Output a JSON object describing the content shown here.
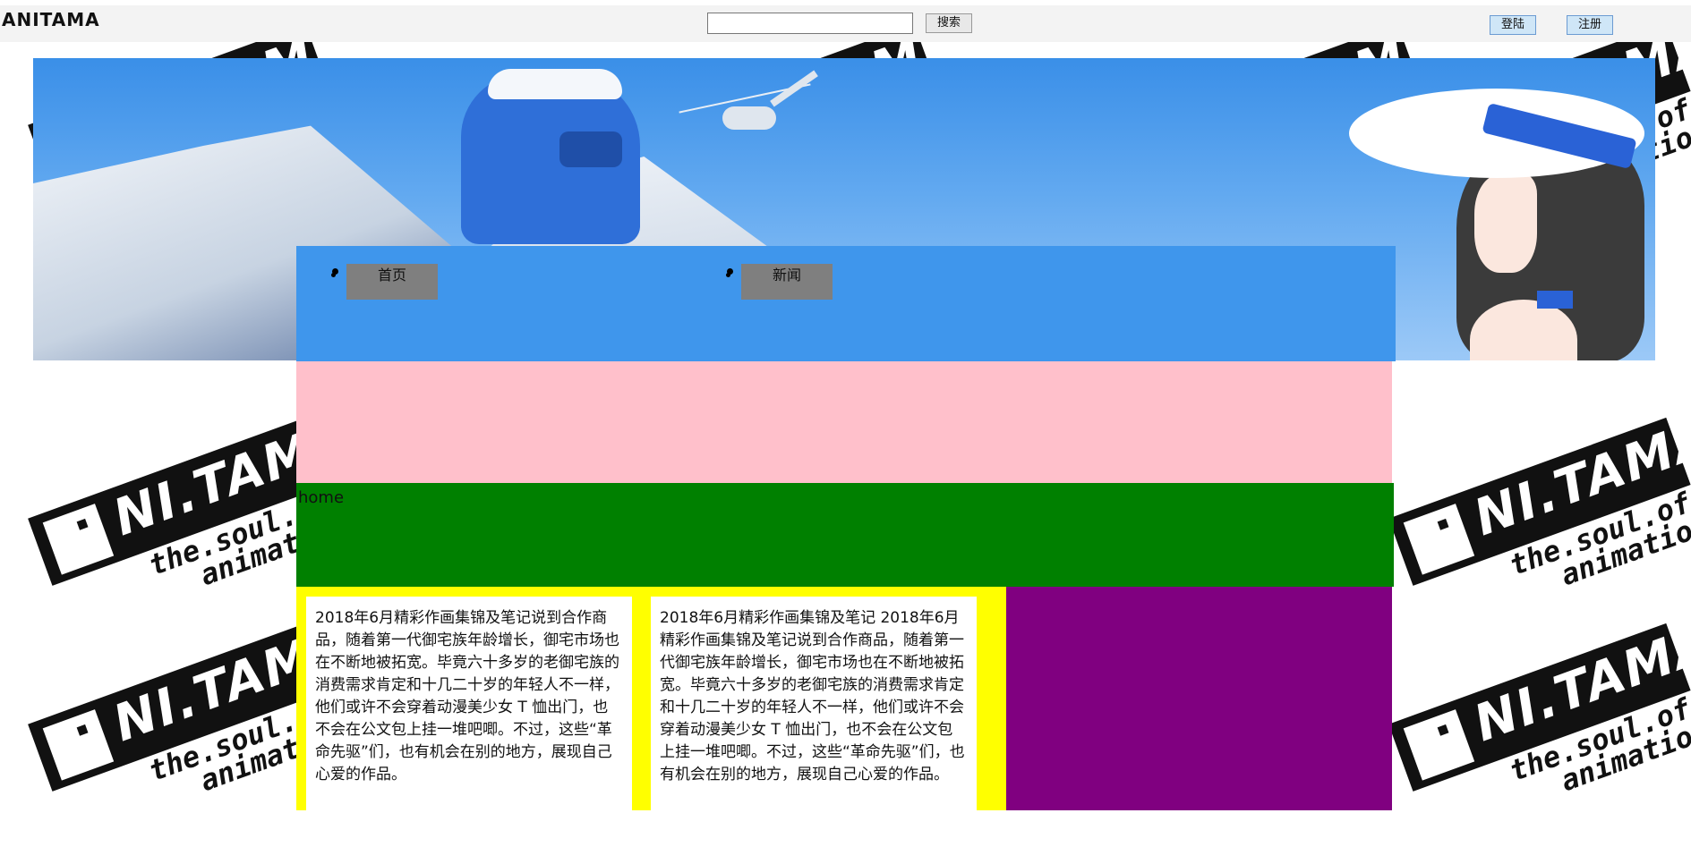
{
  "header": {
    "brand": "ANITAMA",
    "search_placeholder": "",
    "search_button": "搜索",
    "login_button": "登陆",
    "register_button": "注册"
  },
  "nav": {
    "items": [
      {
        "label": "首页"
      },
      {
        "label": "新闻"
      }
    ]
  },
  "sections": {
    "green_label": "home"
  },
  "cards": [
    {
      "text": "2018年6月精彩作画集锦及笔记说到合作商品，随着第一代御宅族年龄增长，御宅市场也在不断地被拓宽。毕竟六十多岁的老御宅族的消费需求肯定和十几二十岁的年轻人不一样，他们或许不会穿着动漫美少女 T 恤出门，也不会在公文包上挂一堆吧唧。不过，这些“革命先驱”们，也有机会在别的地方，展现自己心爱的作品。"
    },
    {
      "text": "2018年6月精彩作画集锦及笔记 2018年6月精彩作画集锦及笔记说到合作商品，随着第一代御宅族年龄增长，御宅市场也在不断地被拓宽。毕竟六十多岁的老御宅族的消费需求肯定和十几二十岁的年轻人不一样，他们或许不会穿着动漫美少女 T 恤出门，也不会在公文包上挂一堆吧唧。不过，这些“革命先驱”们，也有机会在别的地方，展现自己心爱的作品。"
    }
  ],
  "watermark": {
    "text1": "NI.TAMA",
    "text2": "the.soul.of",
    "text3": "animation"
  },
  "colors": {
    "nav_bg": "#3f96ec",
    "pink": "#ffc0cb",
    "green": "#008000",
    "yellow": "#ffff00",
    "purple": "#800080"
  }
}
